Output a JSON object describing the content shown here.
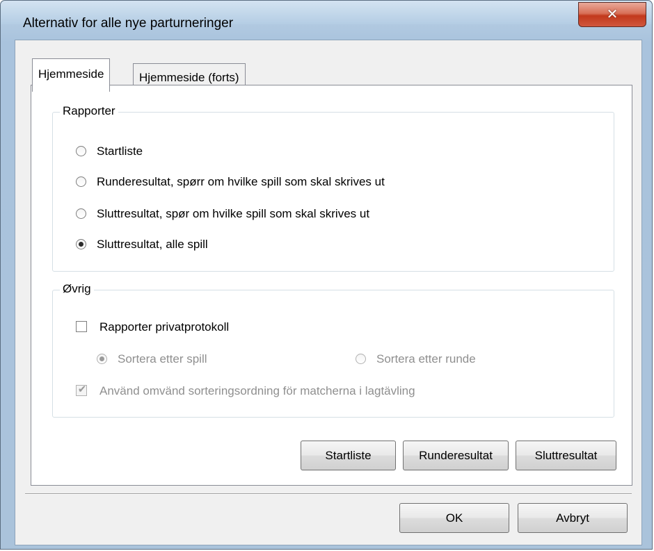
{
  "window": {
    "title": "Alternativ for alle nye parturneringer",
    "close_glyph": "✕"
  },
  "tabs": [
    {
      "label": "Hjemmeside",
      "active": true
    },
    {
      "label": "Hjemmeside (forts)",
      "active": false
    }
  ],
  "rapporter": {
    "label": "Rapporter",
    "options": [
      {
        "label": "Startliste",
        "checked": false
      },
      {
        "label": "Runderesultat, spørr om hvilke spill som skal skrives ut",
        "checked": false
      },
      {
        "label": "Sluttresultat, spør om hvilke spill som skal skrives ut",
        "checked": false
      },
      {
        "label": "Sluttresultat, alle spill",
        "checked": true
      }
    ]
  },
  "ovrig": {
    "label": "Øvrig",
    "privat_checkbox": {
      "label": "Rapporter privatprotokoll",
      "checked": false
    },
    "sort_options": [
      {
        "label": "Sortera etter spill",
        "checked": true,
        "disabled": true
      },
      {
        "label": "Sortera etter runde",
        "checked": false,
        "disabled": true
      }
    ],
    "reverse_checkbox": {
      "label": "Använd omvänd sorteringsordning för matcherna i lagtävling",
      "checked": true,
      "disabled": true
    }
  },
  "report_buttons": {
    "startliste": "Startliste",
    "runderesultat": "Runderesultat",
    "sluttresultat": "Sluttresultat"
  },
  "footer": {
    "ok": "OK",
    "cancel": "Avbryt"
  },
  "colors": {
    "window_frame": "#aac3db",
    "close_button": "#c2391c",
    "dialog_bg": "#f0f0f0"
  }
}
